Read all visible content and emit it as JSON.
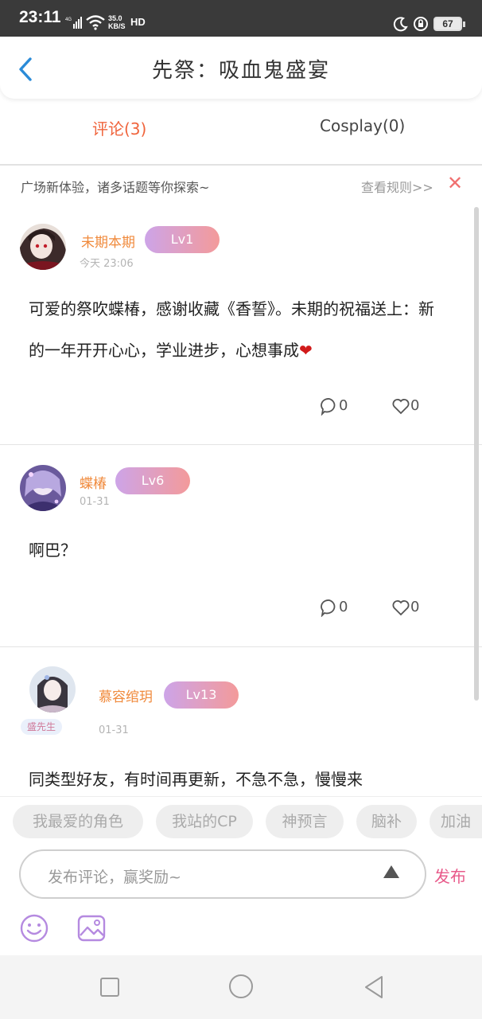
{
  "status_bar": {
    "time": "23:11",
    "network": "4G",
    "speed_value": "35.0",
    "speed_unit": "KB/S",
    "hd": "HD",
    "battery": "67"
  },
  "header": {
    "title": "先祭：吸血鬼盛宴"
  },
  "tabs": [
    {
      "label": "评论(3)",
      "active": true
    },
    {
      "label": "Cosplay(0)",
      "active": false
    }
  ],
  "notice": {
    "text": "广场新体验，诸多话题等你探索~",
    "rules_link": "查看规则>>",
    "close": "✕"
  },
  "posts": [
    {
      "username": "未期本期",
      "level": "Lv1",
      "time": "今天 23:06",
      "content": "可爱的祭吹蝶椿，感谢收藏《香誓》。未期的祝福送上：新的一年开开心心，学业进步，心想事成",
      "emoji": "❤",
      "comments": "0",
      "likes": "0"
    },
    {
      "username": "蝶椿",
      "level": "Lv6",
      "time": "01-31",
      "content": "啊巴？",
      "comments": "0",
      "likes": "0"
    },
    {
      "username": "慕容绾玥",
      "level": "Lv13",
      "badge": "盛先生",
      "time": "01-31",
      "content": "同类型好友，有时间再更新，不急不急，慢慢来"
    }
  ],
  "composer": {
    "chips": [
      "我最爱的角色",
      "我站的CP",
      "神预言",
      "脑补",
      "加油"
    ],
    "placeholder": "发布评论，赢奖励~",
    "publish": "发布"
  },
  "colors": {
    "accent_orange": "#f0643c",
    "username": "#f08a3c",
    "publish_pink": "#e85a8a",
    "close_red": "#f07070"
  }
}
